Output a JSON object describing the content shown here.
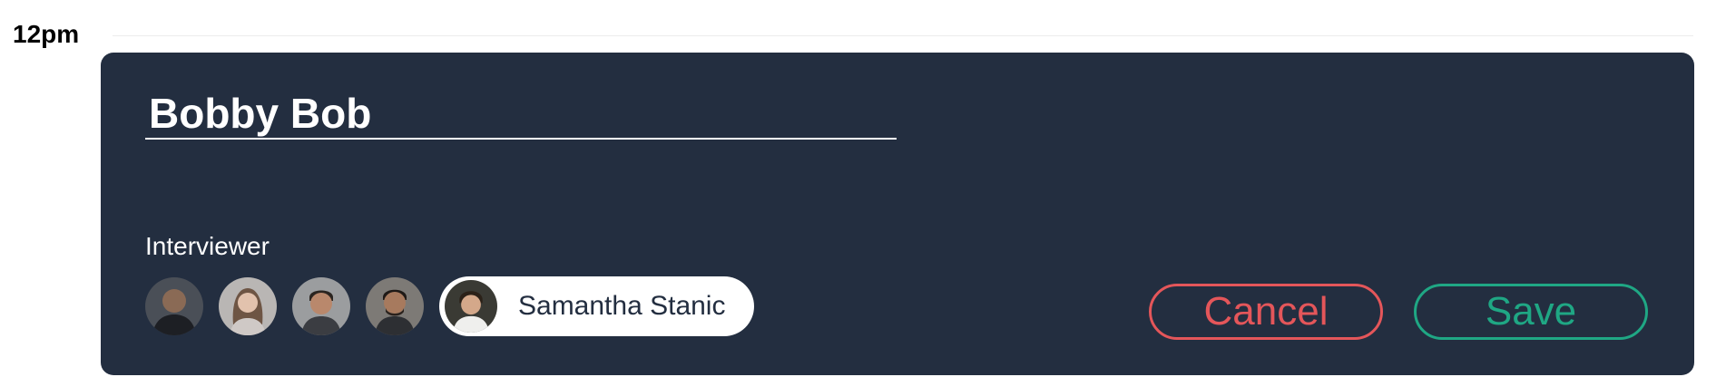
{
  "time_label": "12pm",
  "event": {
    "title_value": "Bobby Bob",
    "interviewer_label": "Interviewer",
    "interviewers": [
      {
        "icon": "person-avatar-icon"
      },
      {
        "icon": "person-avatar-icon"
      },
      {
        "icon": "person-avatar-icon"
      },
      {
        "icon": "person-avatar-icon"
      }
    ],
    "selected_interviewer": {
      "name": "Samantha Stanic",
      "icon": "person-avatar-icon"
    },
    "actions": {
      "cancel_label": "Cancel",
      "save_label": "Save"
    }
  },
  "colors": {
    "card_background": "#232e40",
    "cancel": "#e4565a",
    "save": "#1fa784",
    "text_light": "#ffffff"
  }
}
